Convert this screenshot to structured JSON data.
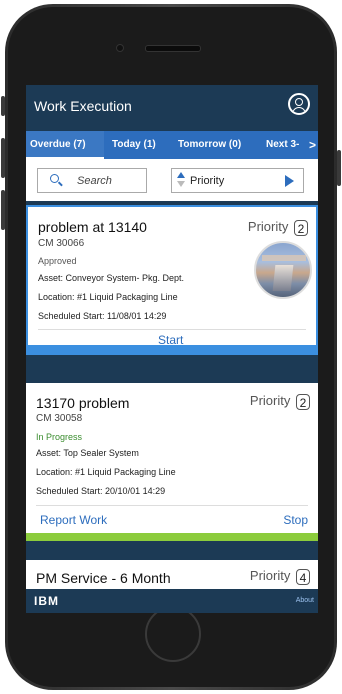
{
  "header": {
    "title": "Work Execution",
    "profile_icon": "user-profile-icon"
  },
  "tabs": [
    {
      "label": "Overdue (7)",
      "active": true
    },
    {
      "label": "Today (1)",
      "active": false
    },
    {
      "label": "Tomorrow (0)",
      "active": false
    },
    {
      "label": "Next 3-",
      "active": false
    }
  ],
  "tabs_more_icon": ">",
  "filters": {
    "search_placeholder": "Search",
    "sort_value": "Priority"
  },
  "cards": [
    {
      "title": "problem at 13140",
      "id": "CM 30066",
      "status": "Approved",
      "asset": "Asset: Conveyor System- Pkg. Dept.",
      "location": "Location: #1 Liquid Packaging Line",
      "scheduled": "Scheduled Start: 11/08/01 14:29",
      "priority_label": "Priority",
      "priority": "2",
      "action": "Start",
      "bar_color": "#3b8fe0"
    },
    {
      "title": "13170 problem",
      "id": "CM 30058",
      "status": "In Progress",
      "asset": "Asset: Top Sealer System",
      "location": "Location: #1 Liquid Packaging Line",
      "scheduled": "Scheduled Start: 20/10/01 14:29",
      "priority_label": "Priority",
      "priority": "2",
      "action_left": "Report Work",
      "action_right": "Stop",
      "bar_color": "#8ccc3c"
    },
    {
      "title": "PM Service - 6 Month",
      "priority_label": "Priority",
      "priority": "4"
    }
  ],
  "footer": {
    "brand": "IBM",
    "about": "About"
  },
  "colors": {
    "header": "#1c3a55",
    "tabs": "#2d6dbd",
    "accent": "#2d6dbd",
    "in_progress": "#3b8d2f"
  }
}
